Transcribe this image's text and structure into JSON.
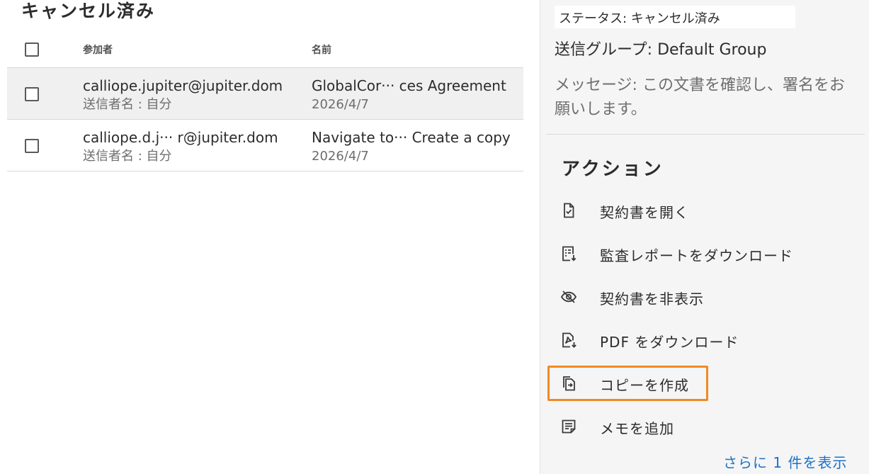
{
  "list": {
    "title": "キャンセル済み",
    "columns": {
      "participant": "参加者",
      "name": "名前"
    },
    "rows": [
      {
        "email": "calliope.jupiter@jupiter.dom",
        "sender": "送信者名 : 自分",
        "name": "GlobalCor···  ces Agreement",
        "date": "2026/4/7"
      },
      {
        "email": "calliope.d.j··· r@jupiter.dom",
        "sender": "送信者名 : 自分",
        "name": "Navigate to···  Create a copy",
        "date": "2026/4/7"
      }
    ]
  },
  "detail": {
    "status": "ステータス: キャンセル済み",
    "group": "送信グループ: Default Group",
    "message": "メッセージ: この文書を確認し、署名をお願いします。",
    "actions_title": "アクション",
    "actions": [
      {
        "label": "契約書を開く",
        "icon": "document-check-icon"
      },
      {
        "label": "監査レポートをダウンロード",
        "icon": "report-download-icon"
      },
      {
        "label": "契約書を非表示",
        "icon": "eye-off-icon"
      },
      {
        "label": "PDF をダウンロード",
        "icon": "pdf-download-icon"
      },
      {
        "label": "コピーを作成",
        "icon": "copy-document-icon"
      },
      {
        "label": "メモを追加",
        "icon": "note-icon"
      }
    ],
    "show_more": "さらに 1 件を表示"
  },
  "colors": {
    "highlight": "#f08a24",
    "link": "#1a73c8",
    "selected_row": "#f0f0f0"
  }
}
